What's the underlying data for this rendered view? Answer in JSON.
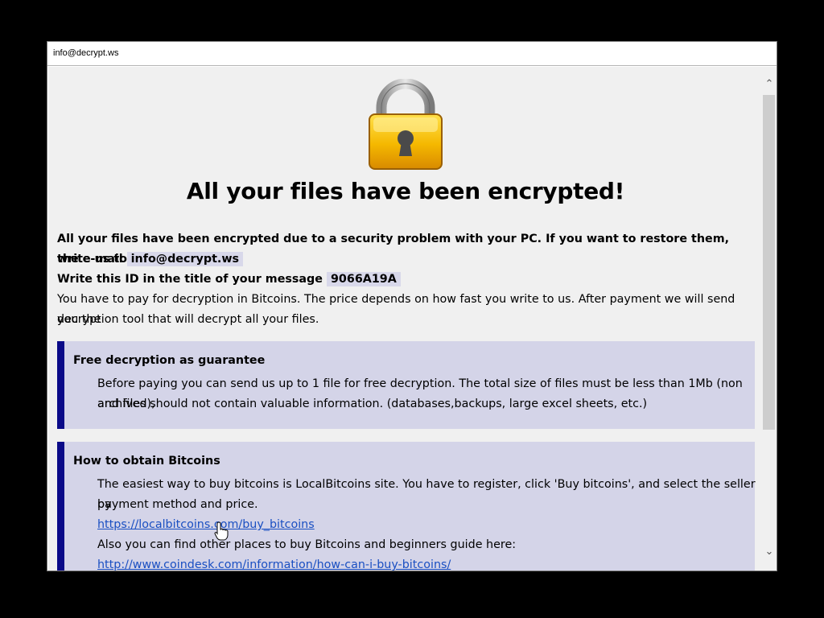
{
  "window": {
    "title": "info@decrypt.ws"
  },
  "headline": "All your files have been encrypted!",
  "intro": {
    "line1": "All your files have been encrypted due to a security problem with your PC. If you want to restore them, write us to",
    "line2_prefix": "the e-mail",
    "email": "info@decrypt.ws",
    "id_prefix": "Write this ID in the title of your message",
    "id": "9066A19A",
    "pay_line1": "You have to pay for decryption in Bitcoins. The price depends on how fast you write to us. After payment we will send you the",
    "pay_line2": "decryption tool that will decrypt all your files."
  },
  "guarantee": {
    "title": "Free decryption as guarantee",
    "line1": "Before paying you can send us up to 1 file for free decryption. The total size of files must be less than 1Mb (non archived),",
    "line2": "and files should not contain valuable information. (databases,backups, large excel sheets, etc.)"
  },
  "bitcoins": {
    "title": "How to obtain Bitcoins",
    "line1": "The easiest way to buy bitcoins is LocalBitcoins site. You have to register, click 'Buy bitcoins', and select the seller by",
    "line2": "payment method and price.",
    "link1": "https://localbitcoins.com/buy_bitcoins",
    "line3": "Also you can find other places to buy Bitcoins and beginners guide here:",
    "link2": "http://www.coindesk.com/information/how-can-i-buy-bitcoins/"
  },
  "icons": {
    "lock": "padlock-icon",
    "scroll_up": "chevron-up-icon",
    "scroll_down": "chevron-down-icon",
    "cursor": "hand-pointer-icon"
  },
  "colors": {
    "box_background": "#d4d4e8",
    "box_accent": "#0a0a88",
    "highlight": "#d8d8ea",
    "link": "#1a4fc2",
    "lock_body": "#f5b800"
  }
}
